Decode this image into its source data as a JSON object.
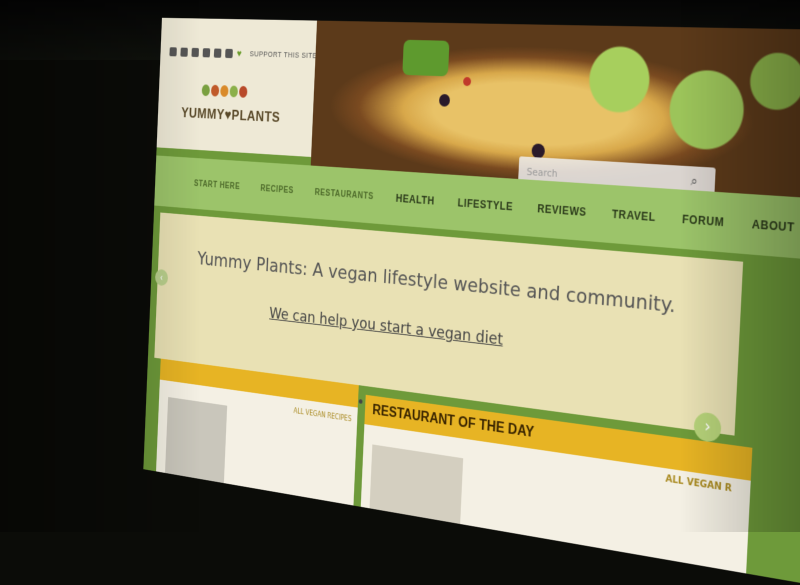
{
  "site": {
    "support_label": "SUPPORT THIS SITE",
    "logo_text": "YUMMY♥PLANTS",
    "search_placeholder": "Search"
  },
  "nav": [
    "START HERE",
    "RECIPES",
    "RESTAURANTS",
    "HEALTH",
    "LIFESTYLE",
    "REVIEWS",
    "TRAVEL",
    "FORUM",
    "ABOUT"
  ],
  "hero": {
    "title": "Yummy Plants: A vegan lifestyle website and community.",
    "link": "We can help you start a vegan diet"
  },
  "cards": {
    "left": {
      "badge": "ALL VEGAN RECIPES"
    },
    "right": {
      "heading": "RESTAURANT OF THE DAY",
      "badge": "ALL VEGAN R"
    }
  },
  "colors": {
    "accent_green": "#9cc46a",
    "hero_bg": "#e9e1b4",
    "band_yellow": "#e7b424"
  }
}
